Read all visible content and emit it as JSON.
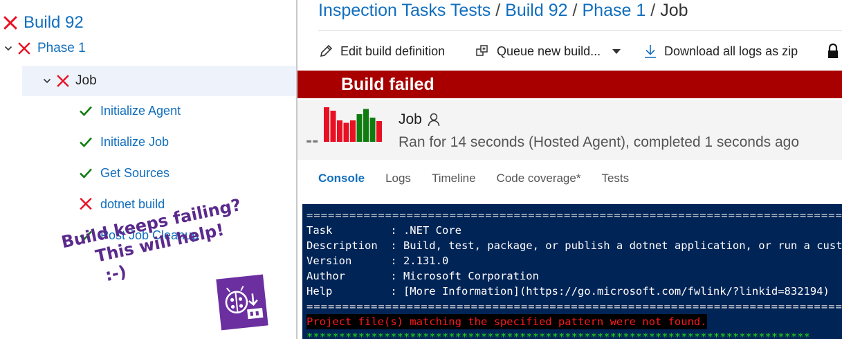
{
  "tree": {
    "build_label": "Build 92",
    "phase_label": "Phase 1",
    "job_label": "Job",
    "steps": [
      {
        "label": "Initialize Agent",
        "status": "succeeded"
      },
      {
        "label": "Initialize Job",
        "status": "succeeded"
      },
      {
        "label": "Get Sources",
        "status": "succeeded"
      },
      {
        "label": "dotnet build",
        "status": "failed"
      },
      {
        "label": "Post Job Cleanup",
        "status": "succeeded"
      }
    ]
  },
  "promo": {
    "line1": "Build keeps failing?",
    "line2": "This will help!",
    "line3": ":-)"
  },
  "breadcrumb": {
    "items": [
      "Inspection Tasks Tests",
      "Build 92",
      "Phase 1"
    ],
    "separator": "/",
    "current": "Job"
  },
  "toolbar": {
    "edit_label": "Edit build definition",
    "queue_label": "Queue new build...",
    "download_label": "Download all logs as zip"
  },
  "banner": {
    "text": "Build failed"
  },
  "job": {
    "title": "Job",
    "subtitle": "Ran for 14 seconds (Hosted Agent), completed 1 seconds ago",
    "spark_placeholder": "--",
    "spark_bars": [
      {
        "status": "failed",
        "level": 1.0
      },
      {
        "status": "failed",
        "level": 0.9
      },
      {
        "status": "failed",
        "level": 0.62
      },
      {
        "status": "failed",
        "level": 0.55
      },
      {
        "status": "failed",
        "level": 0.62
      },
      {
        "status": "succeeded",
        "level": 0.8
      },
      {
        "status": "succeeded",
        "level": 0.95
      },
      {
        "status": "succeeded",
        "level": 0.7
      },
      {
        "status": "failed",
        "level": 0.6
      }
    ]
  },
  "tabs": [
    "Console",
    "Logs",
    "Timeline",
    "Code coverage*",
    "Tests"
  ],
  "active_tab": "Console",
  "console": {
    "separator": "==============================================================================",
    "lines": [
      "Task         : .NET Core",
      "Description  : Build, test, package, or publish a dotnet application, or run a custom dotnet command",
      "Version      : 2.131.0",
      "Author       : Microsoft Corporation",
      "Help         : [More Information](https://go.microsoft.com/fwlink/?linkid=832194)"
    ],
    "error": "Project file(s) matching the specified pattern were not found.",
    "stars": "******************************************************************************"
  },
  "colors": {
    "link": "#106ebe",
    "failed": "#e81123",
    "succeeded": "#107c10",
    "banner": "#a80000",
    "console_bg": "#012456",
    "promo": "#5b2a8c"
  }
}
